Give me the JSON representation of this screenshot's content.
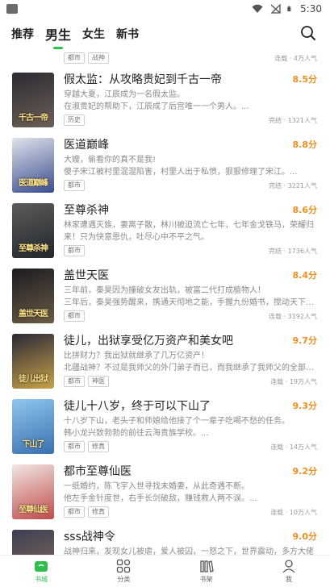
{
  "status_bar": {
    "time": "5:30"
  },
  "topnav": {
    "tabs": [
      {
        "label": "推荐"
      },
      {
        "label": "男生"
      },
      {
        "label": "女生"
      },
      {
        "label": "新书"
      }
    ]
  },
  "partial_item": {
    "tags": [
      "都市",
      "战神"
    ],
    "meta": "连载 · 4万人气"
  },
  "books": [
    {
      "title": "假太监：从攻略贵妃到千古一帝",
      "score": "8.5分",
      "desc": [
        "穿越大夏，江辰成为一名假太监。",
        "在淑贵妃的帮助下，江辰成了后宫唯一一个男人。..."
      ],
      "tags": [
        "历史"
      ],
      "meta": "完结 · 1321人气",
      "cover_text": "千古一帝",
      "colors": [
        "#2c2a33",
        "#6d5f55"
      ]
    },
    {
      "title": "医道巅峰",
      "score": "8.8分",
      "desc": [
        "大嫂，偷看你的真不是我!",
        "傻子宋江被村里混混陷害，村里人出于私愤，狠狠修理了宋江。..."
      ],
      "tags": [
        "都市"
      ],
      "meta": "完结 · 3221人气",
      "cover_text": "医道巅峰",
      "colors": [
        "#dfe3ea",
        "#3a4d8f"
      ]
    },
    {
      "title": "至尊杀神",
      "score": "8.6分",
      "desc": [
        "林家遭遇灭族，妻离子散，林川被迫流亡七年，七年金戈铁马，荣耀归来！只为快意恩仇，吐尽心中不平之气。"
      ],
      "tags": [
        "都市"
      ],
      "meta": "完结 · 1736人气",
      "cover_text": "至尊杀神",
      "colors": [
        "#5b5b5b",
        "#22272c"
      ]
    },
    {
      "title": "盖世天医",
      "score": "8.4分",
      "desc": [
        "三年前，秦昊因为撞破女友出轨，被富二代打成植物人！",
        "三年后，秦昊强势醒来，携通天彻地之能，手握九份婚书，搅动天下风..."
      ],
      "tags": [
        "都市"
      ],
      "meta": "连载 · 3192人气",
      "cover_text": "盖世天医",
      "colors": [
        "#1d1b20",
        "#6a5a45"
      ]
    },
    {
      "title": "徒儿，出狱享受亿万资产和美女吧",
      "score": "9.7分",
      "desc": [
        "比拼财力？我出狱就继承了几万亿资产！",
        "北疆战神？不过是我师父的外门弟子而已，而我继承了我师父的全部衣..."
      ],
      "tags": [
        "都市",
        "神医"
      ],
      "meta": "连载 · 19万人气",
      "cover_text": "徒儿出狱",
      "colors": [
        "#2a2836",
        "#c8a24a"
      ]
    },
    {
      "title": "徒儿十八岁，终于可以下山了",
      "score": "9.3分",
      "desc": [
        "十八岁下山，老头子和师娘给他接了个一辈子吃喝不愁的任务。",
        "韩小龙兴致勃勃的前往云海贵族学校。..."
      ],
      "tags": [
        "都市",
        "修真"
      ],
      "meta": "连载 · 14万人气",
      "cover_text": "下山了",
      "colors": [
        "#8fc7ee",
        "#3a6fb0"
      ]
    },
    {
      "title": "都市至尊仙医",
      "score": "9.2分",
      "desc": [
        "一纸婚约，陈飞宇入世寻找未婚妻，从此奇遇不断。",
        "他左手金针度世，右手长剑破敌，赚钱救人两不误。..."
      ],
      "tags": [
        "都市",
        "修真"
      ],
      "meta": "连载 · 10万人气",
      "cover_text": "至尊仙医",
      "colors": [
        "#f1e7e3",
        "#c04a4a"
      ]
    },
    {
      "title": "sss战神令",
      "score": "9.0分",
      "desc": [
        "战神归来，发现女儿被虐，爱人被囚，一怒之下，世界震动，多方大佬纷"
      ],
      "tags": [],
      "meta": "",
      "cover_text": "",
      "colors": [
        "#3c3f55",
        "#8a6b58"
      ]
    }
  ],
  "bottomnav": {
    "items": [
      {
        "label": "书城"
      },
      {
        "label": "分类"
      },
      {
        "label": "书架"
      },
      {
        "label": "我"
      }
    ]
  },
  "accent_color": "#2fbf4f",
  "score_color": "#ef8f1f"
}
